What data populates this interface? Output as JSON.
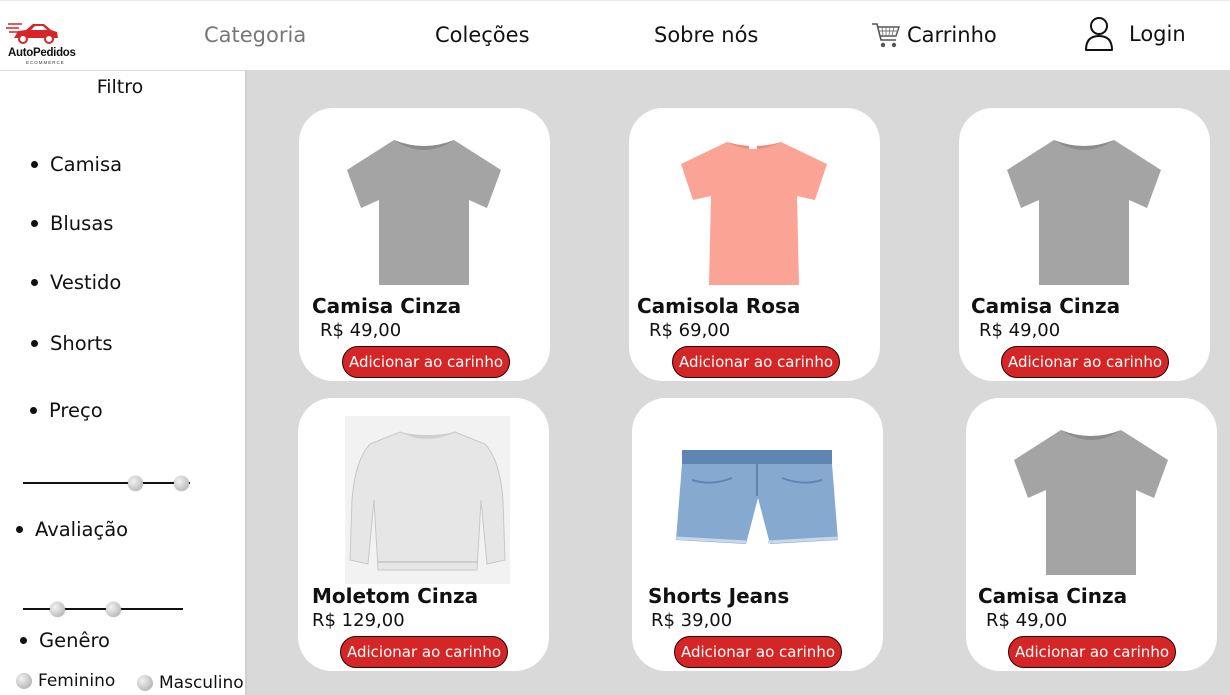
{
  "header": {
    "logo_text": "AutoPedidos",
    "logo_subtext": "ECOMMERCE",
    "nav": {
      "categoria": "Categoria",
      "colecoes": "Coleções",
      "sobre": "Sobre nós"
    },
    "cart_label": "Carrinho",
    "login_label": "Login",
    "brand_color": "#d42626"
  },
  "sidebar": {
    "title": "Filtro",
    "categories": [
      "Camisa",
      "Blusas",
      "Vestido",
      "Shorts"
    ],
    "price_label": "Preço",
    "rating_label": "Avaliação",
    "gender_label": "Genêro",
    "gender_options": [
      "Feminino",
      "Masculino"
    ]
  },
  "products": [
    {
      "name": "Camisa Cinza",
      "price": "R$ 49,00",
      "button": "Adicionar ao carinho",
      "image": "tshirt-gray-icon"
    },
    {
      "name": "Camisola Rosa",
      "price": "R$ 69,00",
      "button": "Adicionar ao carinho",
      "image": "tshirt-pink-icon"
    },
    {
      "name": "Camisa Cinza",
      "price": "R$ 49,00",
      "button": "Adicionar ao carinho",
      "image": "tshirt-gray-icon"
    },
    {
      "name": "Moletom Cinza",
      "price": "R$ 129,00",
      "button": "Adicionar ao carinho",
      "image": "sweatshirt-icon"
    },
    {
      "name": "Shorts Jeans",
      "price": "R$ 39,00",
      "button": "Adicionar ao carinho",
      "image": "jeans-shorts-icon"
    },
    {
      "name": "Camisa Cinza",
      "price": "R$ 49,00",
      "button": "Adicionar ao carinho",
      "image": "tshirt-gray-icon"
    }
  ]
}
